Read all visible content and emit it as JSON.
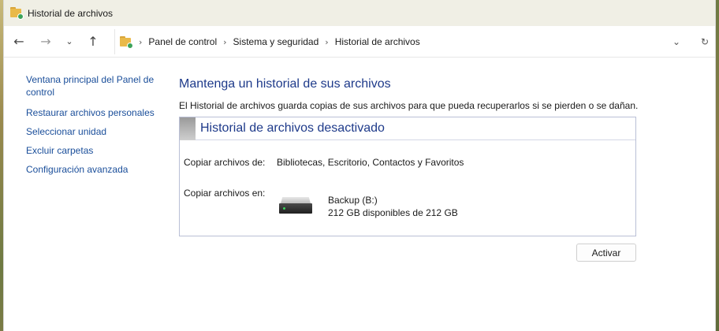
{
  "window": {
    "title": "Historial de archivos"
  },
  "nav": {
    "back_glyph": "←",
    "forward_glyph": "→",
    "recent_glyph": "⌄",
    "up_glyph": "↑",
    "dropdown_glyph": "⌄",
    "refresh_glyph": "↻"
  },
  "breadcrumb": [
    "Panel de control",
    "Sistema y seguridad",
    "Historial de archivos"
  ],
  "breadcrumb_sep": "›",
  "sidebar": {
    "items": [
      {
        "label": "Ventana principal del Panel de control"
      },
      {
        "label": "Restaurar archivos personales"
      },
      {
        "label": "Seleccionar unidad"
      },
      {
        "label": "Excluir carpetas"
      },
      {
        "label": "Configuración avanzada"
      }
    ]
  },
  "main": {
    "heading": "Mantenga un historial de sus archivos",
    "description": "El Historial de archivos guarda copias de sus archivos para que pueda recuperarlos si se pierden o se dañan.",
    "panel": {
      "title": "Historial de archivos desactivado",
      "copy_from_label": "Copiar archivos de:",
      "copy_from_value": "Bibliotecas, Escritorio, Contactos y Favoritos",
      "copy_to_label": "Copiar archivos en:",
      "drive_name": "Backup (B:)",
      "drive_space": "212 GB disponibles de 212 GB"
    },
    "activate_button": "Activar"
  },
  "colors": {
    "link": "#1a4e9a",
    "heading": "#1e3a8a",
    "titlebar": "#f0efe5",
    "panel_border": "#b9bfd6"
  },
  "icons": {
    "app": "folder-history-icon",
    "drive": "hard-drive-icon"
  }
}
